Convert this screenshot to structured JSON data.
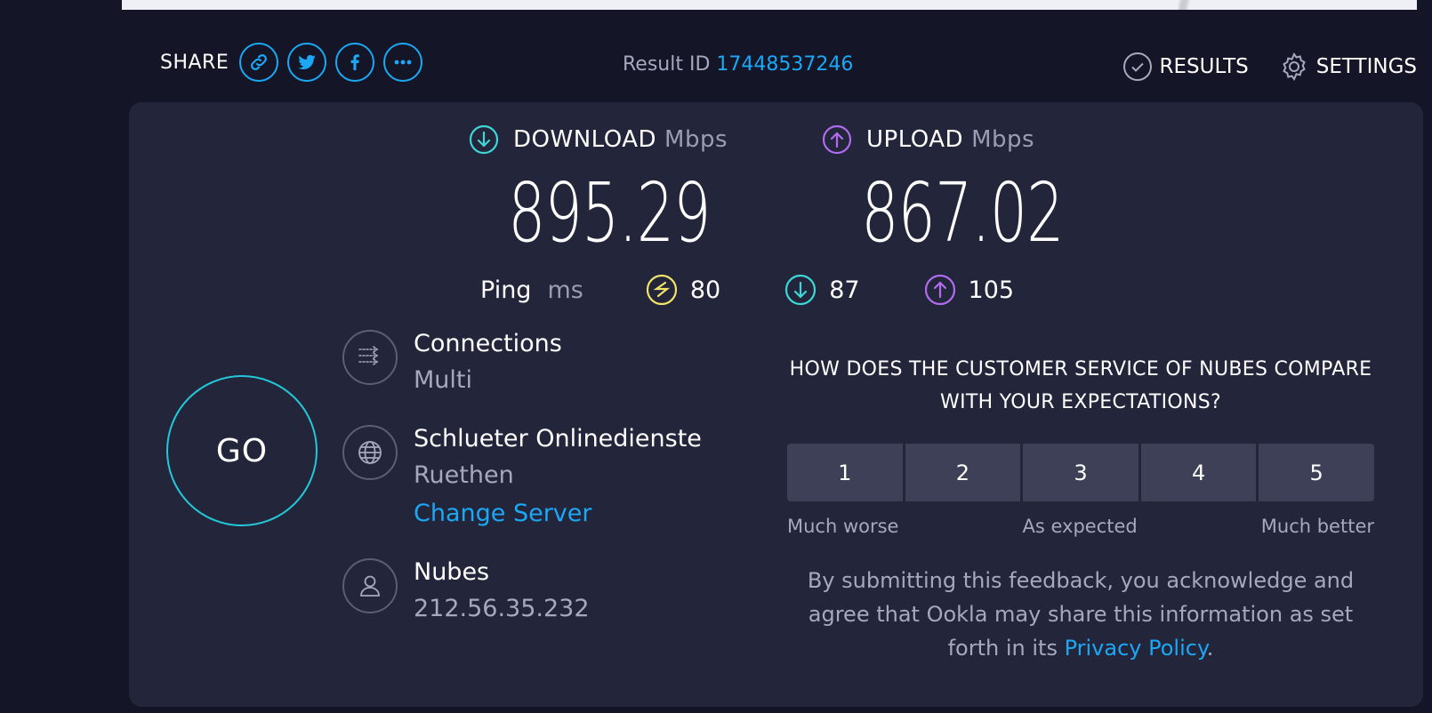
{
  "header": {
    "share_label": "SHARE",
    "share_buttons": [
      "link-icon",
      "twitter-icon",
      "facebook-icon",
      "more-icon"
    ],
    "result_id_label": "Result ID",
    "result_id": "17448537246",
    "results_label": "RESULTS",
    "settings_label": "SETTINGS"
  },
  "download": {
    "label": "DOWNLOAD",
    "unit": "Mbps",
    "value": "895.29",
    "color": "#3fd6d6"
  },
  "upload": {
    "label": "UPLOAD",
    "unit": "Mbps",
    "value": "867.02",
    "color": "#b06cf0"
  },
  "ping": {
    "label": "Ping",
    "unit": "ms",
    "idle": "80",
    "download": "87",
    "upload": "105",
    "idle_color": "#f2e36b"
  },
  "go_label": "GO",
  "connections": {
    "title": "Connections",
    "value": "Multi"
  },
  "server": {
    "title": "Schlueter Onlinedienste",
    "location": "Ruethen",
    "change_label": "Change Server"
  },
  "provider": {
    "title": "Nubes",
    "ip": "212.56.35.232"
  },
  "survey": {
    "question": "HOW DOES THE CUSTOMER SERVICE OF NUBES COMPARE WITH YOUR EXPECTATIONS?",
    "ratings": [
      "1",
      "2",
      "3",
      "4",
      "5"
    ],
    "low_label": "Much worse",
    "mid_label": "As expected",
    "high_label": "Much better",
    "disclaimer": "By submitting this feedback, you acknowledge and agree that Ookla may share this information as set forth in its",
    "privacy_link": "Privacy Policy",
    "period": "."
  },
  "colors": {
    "accent": "#1ca8f5",
    "go_ring": "#23c8d8",
    "card_bg": "#23253a",
    "page_bg": "#141526"
  }
}
